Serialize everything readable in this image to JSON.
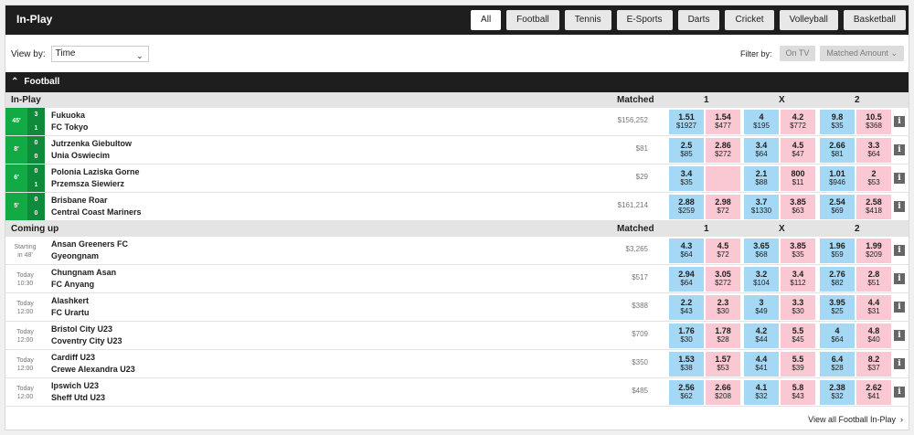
{
  "header": {
    "title": "In-Play",
    "tabs": [
      {
        "label": "All",
        "active": true
      },
      {
        "label": "Football"
      },
      {
        "label": "Tennis"
      },
      {
        "label": "E-Sports"
      },
      {
        "label": "Darts"
      },
      {
        "label": "Cricket"
      },
      {
        "label": "Volleyball"
      },
      {
        "label": "Basketball"
      }
    ]
  },
  "controls": {
    "view_by_label": "View by:",
    "view_by_value": "Time",
    "filter_by_label": "Filter by:",
    "on_tv": "On TV",
    "matched_amount": "Matched Amount"
  },
  "sport": {
    "name": "Football"
  },
  "columns": {
    "matched": "Matched",
    "home": "1",
    "draw": "X",
    "away": "2"
  },
  "sections": [
    {
      "title": "In-Play",
      "rows": [
        {
          "minute": "45'",
          "score": [
            "3",
            "1"
          ],
          "home": "Fukuoka",
          "away": "FC Tokyo",
          "matched": "$156,252",
          "odds": [
            [
              "1.51",
              "$1927"
            ],
            [
              "1.54",
              "$477"
            ],
            [
              "4",
              "$195"
            ],
            [
              "4.2",
              "$772"
            ],
            [
              "9.8",
              "$35"
            ],
            [
              "10.5",
              "$368"
            ]
          ]
        },
        {
          "minute": "8'",
          "score": [
            "0",
            "0"
          ],
          "home": "Jutrzenka Giebultow",
          "away": "Unia Oswiecim",
          "matched": "$81",
          "odds": [
            [
              "2.5",
              "$85"
            ],
            [
              "2.86",
              "$272"
            ],
            [
              "3.4",
              "$64"
            ],
            [
              "4.5",
              "$47"
            ],
            [
              "2.66",
              "$81"
            ],
            [
              "3.3",
              "$64"
            ]
          ]
        },
        {
          "minute": "6'",
          "score": [
            "0",
            "1"
          ],
          "home": "Polonia Laziska Gorne",
          "away": "Przemsza Siewierz",
          "matched": "$29",
          "odds": [
            [
              "3.4",
              "$35"
            ],
            [
              "",
              ""
            ],
            [
              "2.1",
              "$88"
            ],
            [
              "800",
              "$11"
            ],
            [
              "1.01",
              "$946"
            ],
            [
              "2",
              "$53"
            ]
          ]
        },
        {
          "minute": "5'",
          "score": [
            "0",
            "0"
          ],
          "home": "Brisbane Roar",
          "away": "Central Coast Mariners",
          "matched": "$161,214",
          "odds": [
            [
              "2.88",
              "$259"
            ],
            [
              "2.98",
              "$72"
            ],
            [
              "3.7",
              "$1330"
            ],
            [
              "3.85",
              "$63"
            ],
            [
              "2.54",
              "$69"
            ],
            [
              "2.58",
              "$418"
            ]
          ]
        }
      ]
    },
    {
      "title": "Coming up",
      "rows": [
        {
          "time": [
            "Starting",
            "in 48'"
          ],
          "home": "Ansan Greeners FC",
          "away": "Gyeongnam",
          "matched": "$3,265",
          "odds": [
            [
              "4.3",
              "$64"
            ],
            [
              "4.5",
              "$72"
            ],
            [
              "3.65",
              "$68"
            ],
            [
              "3.85",
              "$35"
            ],
            [
              "1.96",
              "$59"
            ],
            [
              "1.99",
              "$209"
            ]
          ]
        },
        {
          "time": [
            "Today",
            "10:30"
          ],
          "home": "Chungnam Asan",
          "away": "FC Anyang",
          "matched": "$517",
          "odds": [
            [
              "2.94",
              "$64"
            ],
            [
              "3.05",
              "$272"
            ],
            [
              "3.2",
              "$104"
            ],
            [
              "3.4",
              "$112"
            ],
            [
              "2.76",
              "$82"
            ],
            [
              "2.8",
              "$51"
            ]
          ]
        },
        {
          "time": [
            "Today",
            "12:00"
          ],
          "home": "Alashkert",
          "away": "FC Urartu",
          "matched": "$388",
          "odds": [
            [
              "2.2",
              "$43"
            ],
            [
              "2.3",
              "$30"
            ],
            [
              "3",
              "$49"
            ],
            [
              "3.3",
              "$30"
            ],
            [
              "3.95",
              "$25"
            ],
            [
              "4.4",
              "$31"
            ]
          ]
        },
        {
          "time": [
            "Today",
            "12:00"
          ],
          "home": "Bristol City U23",
          "away": "Coventry City U23",
          "matched": "$709",
          "odds": [
            [
              "1.76",
              "$30"
            ],
            [
              "1.78",
              "$28"
            ],
            [
              "4.2",
              "$44"
            ],
            [
              "5.5",
              "$45"
            ],
            [
              "4",
              "$64"
            ],
            [
              "4.8",
              "$40"
            ]
          ]
        },
        {
          "time": [
            "Today",
            "12:00"
          ],
          "home": "Cardiff U23",
          "away": "Crewe Alexandra U23",
          "matched": "$350",
          "odds": [
            [
              "1.53",
              "$38"
            ],
            [
              "1.57",
              "$53"
            ],
            [
              "4.4",
              "$41"
            ],
            [
              "5.5",
              "$39"
            ],
            [
              "6.4",
              "$28"
            ],
            [
              "8.2",
              "$37"
            ]
          ]
        },
        {
          "time": [
            "Today",
            "12:00"
          ],
          "home": "Ipswich U23",
          "away": "Sheff Utd U23",
          "matched": "$485",
          "odds": [
            [
              "2.56",
              "$62"
            ],
            [
              "2.66",
              "$208"
            ],
            [
              "4.1",
              "$32"
            ],
            [
              "5.8",
              "$43"
            ],
            [
              "2.38",
              "$32"
            ],
            [
              "2.62",
              "$41"
            ]
          ]
        }
      ]
    }
  ],
  "footer": {
    "view_all": "View all Football In-Play"
  },
  "colors": {
    "back": "#a4d8f4",
    "lay": "#f9c8d3",
    "live": "#11aa45",
    "header": "#1e1e1e"
  }
}
